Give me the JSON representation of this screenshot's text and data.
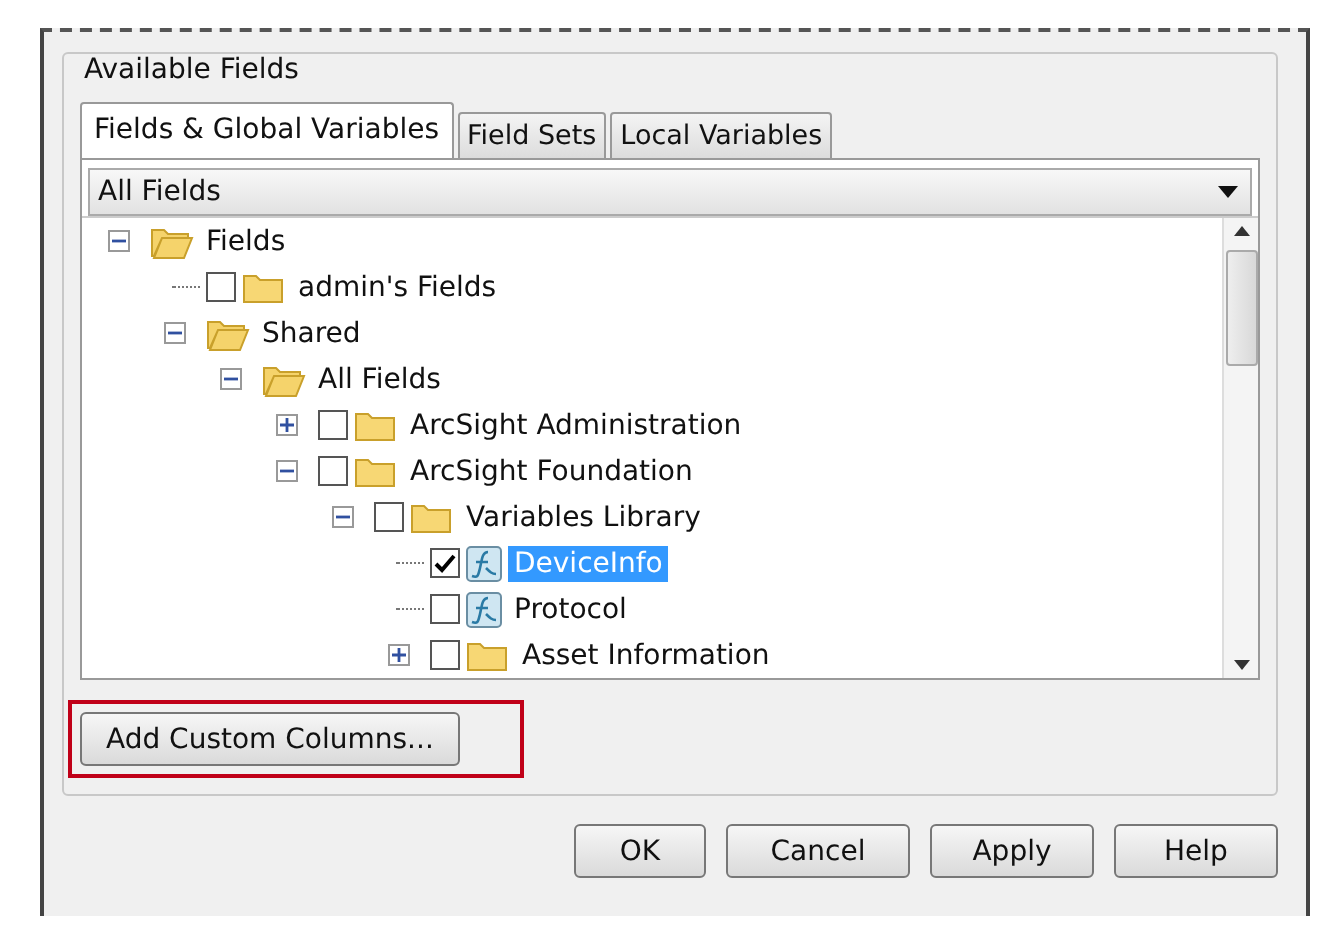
{
  "group_title": "Available Fields",
  "tabs": [
    {
      "label": "Fields & Global Variables",
      "selected": true
    },
    {
      "label": "Field Sets",
      "selected": false
    },
    {
      "label": "Local Variables",
      "selected": false
    }
  ],
  "filter": {
    "value": "All Fields"
  },
  "tree": [
    {
      "label": "Fields",
      "kind": "open-folder",
      "expanded": true,
      "selected": false,
      "children": [
        {
          "label": "admin's Fields",
          "kind": "folder",
          "checked": false,
          "selected": false
        },
        {
          "label": "Shared",
          "kind": "open-folder",
          "expanded": true,
          "selected": false,
          "children": [
            {
              "label": "All Fields",
              "kind": "open-folder",
              "expanded": true,
              "selected": false,
              "children": [
                {
                  "label": "ArcSight Administration",
                  "kind": "folder",
                  "expanded": false,
                  "checked": false,
                  "selected": false
                },
                {
                  "label": "ArcSight Foundation",
                  "kind": "folder",
                  "expanded": true,
                  "checked": false,
                  "selected": false,
                  "children": [
                    {
                      "label": "Variables Library",
                      "kind": "folder",
                      "expanded": true,
                      "checked": false,
                      "selected": false,
                      "children": [
                        {
                          "label": "DeviceInfo",
                          "kind": "variable",
                          "checked": true,
                          "selected": true
                        },
                        {
                          "label": "Protocol",
                          "kind": "variable",
                          "checked": false,
                          "selected": false
                        },
                        {
                          "label": "Asset Information",
                          "kind": "folder",
                          "expanded": false,
                          "checked": false,
                          "selected": false
                        }
                      ]
                    }
                  ]
                }
              ]
            }
          ]
        }
      ]
    }
  ],
  "custom_button": "Add Custom Columns...",
  "buttons": [
    "OK",
    "Cancel",
    "Apply",
    "Help"
  ]
}
